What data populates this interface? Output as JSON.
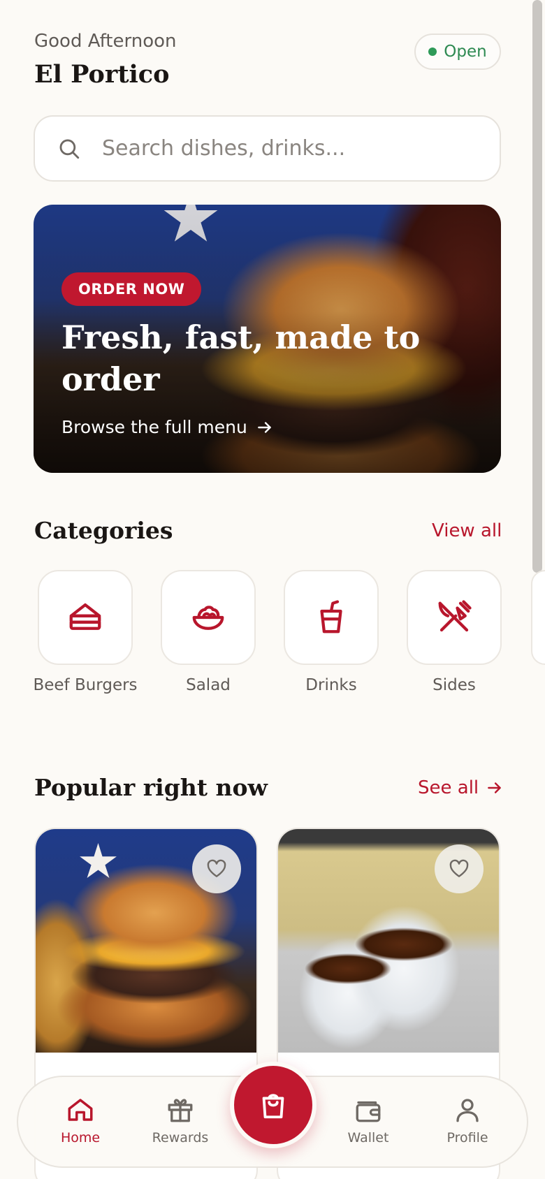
{
  "header": {
    "greeting": "Good Afternoon",
    "restaurant_name": "El Portico",
    "status_label": "Open"
  },
  "search": {
    "placeholder": "Search dishes, drinks..."
  },
  "hero": {
    "badge": "ORDER NOW",
    "title": "Fresh, fast, made to order",
    "link_label": "Browse the full menu"
  },
  "categories": {
    "title": "Categories",
    "view_all_label": "View all",
    "items": [
      {
        "label": "Beef Burgers",
        "icon": "sandwich-icon"
      },
      {
        "label": "Salad",
        "icon": "salad-bowl-icon"
      },
      {
        "label": "Drinks",
        "icon": "cup-icon"
      },
      {
        "label": "Sides",
        "icon": "utensils-crossed-icon"
      }
    ]
  },
  "popular": {
    "title": "Popular right now",
    "see_all_label": "See all"
  },
  "nav": {
    "items": [
      {
        "label": "Home",
        "icon": "home-icon",
        "active": true
      },
      {
        "label": "Rewards",
        "icon": "gift-icon",
        "active": false
      },
      {
        "label": "Wallet",
        "icon": "wallet-icon",
        "active": false
      },
      {
        "label": "Profile",
        "icon": "user-icon",
        "active": false
      }
    ],
    "cart_icon": "shopping-bag-icon"
  },
  "colors": {
    "accent": "#c0182f",
    "status_green": "#2e8a52",
    "background": "#fcfaf6"
  }
}
